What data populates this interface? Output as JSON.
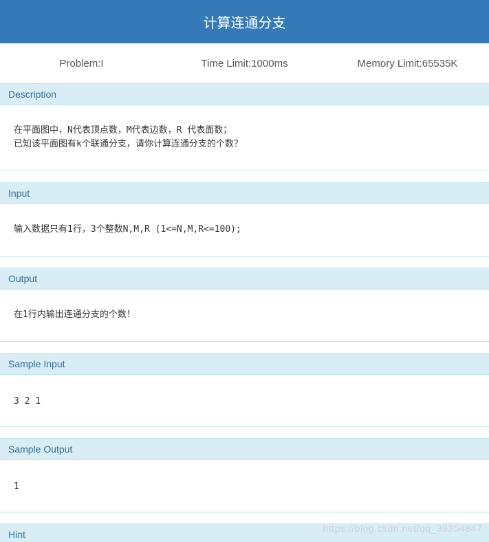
{
  "title": "计算连通分支",
  "meta": {
    "problem": "Problem:I",
    "time_limit": "Time Limit:1000ms",
    "memory_limit": "Memory Limit:65535K"
  },
  "sections": {
    "description": {
      "label": "Description",
      "text": "在平面图中，N代表顶点数，M代表边数，R 代表面数；\n已知该平面图有k个联通分支，请你计算连通分支的个数？"
    },
    "input": {
      "label": "Input",
      "text": "输入数据只有1行，3个整数N,M,R (1<=N,M,R<=100);"
    },
    "output": {
      "label": "Output",
      "text": "在1行内输出连通分支的个数！"
    },
    "sample_input": {
      "label": "Sample Input",
      "text": "3 2 1"
    },
    "sample_output": {
      "label": "Sample Output",
      "text": "1"
    },
    "hint": {
      "label": "Hint"
    }
  },
  "watermark": "https://blog.csdn.net/qq_39354847"
}
